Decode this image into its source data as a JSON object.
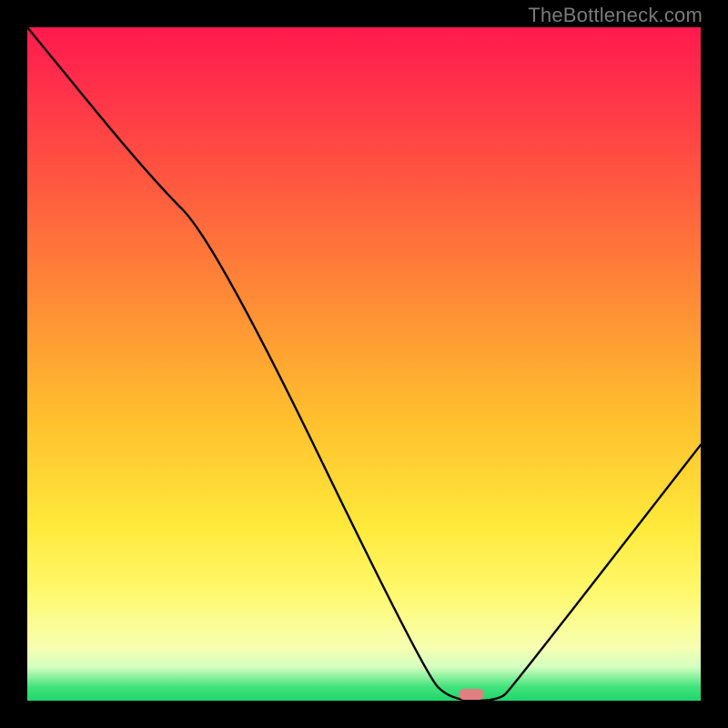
{
  "watermark": "TheBottleneck.com",
  "chart_data": {
    "type": "line",
    "title": "",
    "xlabel": "",
    "ylabel": "",
    "xlim": [
      0,
      100
    ],
    "ylim": [
      0,
      100
    ],
    "grid": false,
    "legend": false,
    "series": [
      {
        "name": "bottleneck-curve",
        "x": [
          0,
          18,
          28,
          59,
          63,
          70,
          72,
          100
        ],
        "values": [
          100,
          78,
          68,
          4,
          0,
          0,
          2,
          38
        ]
      }
    ],
    "marker": {
      "x": 66,
      "y": 1
    },
    "gradient_stops": [
      {
        "pct": 0,
        "color": "#ff1a4d"
      },
      {
        "pct": 50,
        "color": "#ffa733"
      },
      {
        "pct": 80,
        "color": "#fff050"
      },
      {
        "pct": 100,
        "color": "#1fd66c"
      }
    ]
  }
}
